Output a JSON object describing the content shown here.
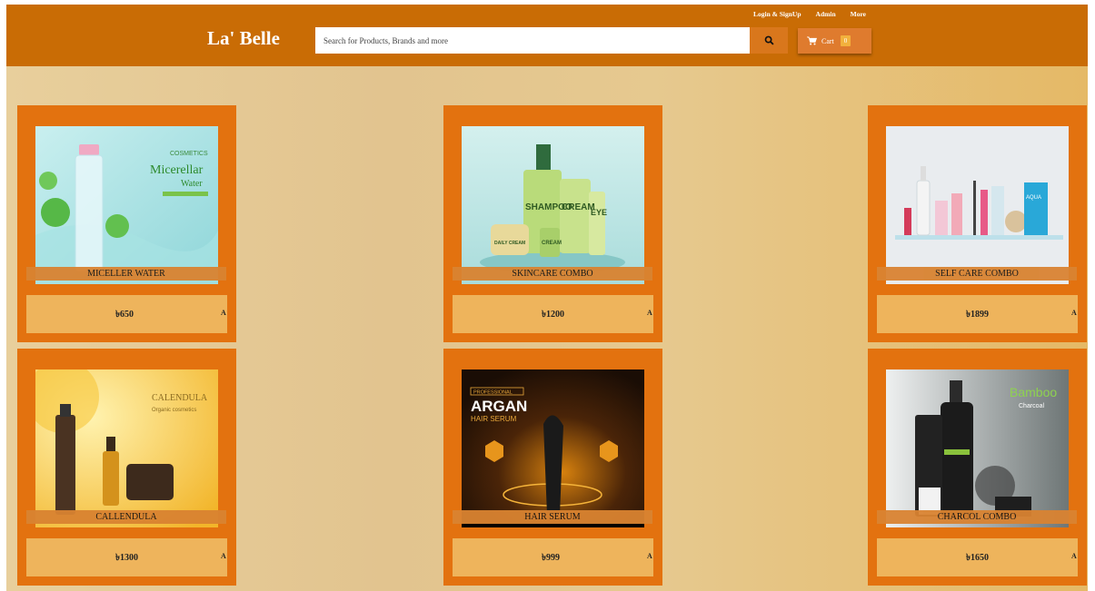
{
  "header": {
    "logo": "La' Belle",
    "links": [
      "Login & SignUp",
      "Admin",
      "More"
    ],
    "search_placeholder": "Search for Products, Brands and more",
    "cart_label": "Cart",
    "cart_count": "0"
  },
  "colors": {
    "header": "#c96c05",
    "card": "#e3720f",
    "price_box": "#eeb45c"
  },
  "products": [
    {
      "name": "MICELLER WATER",
      "price": "৳650",
      "add_label": "Add to Cart",
      "image_text": [
        "COSMETICS",
        "Micerellar",
        "Water"
      ]
    },
    {
      "name": "SKINCARE COMBO",
      "price": "৳1200",
      "add_label": "Add to Cart",
      "image_text": [
        "SHAMPOO",
        "CREAM",
        "EYE",
        "CREAM",
        "DAILY CREAM"
      ]
    },
    {
      "name": "SELF CARE COMBO",
      "price": "৳1899",
      "add_label": "Add to Cart",
      "image_text": [
        "AQUA"
      ]
    },
    {
      "name": "CALLENDULA",
      "price": "৳1300",
      "add_label": "Add to Cart",
      "image_text": [
        "CALENDULA",
        "Organic cosmetics"
      ]
    },
    {
      "name": "HAIR SERUM",
      "price": "৳999",
      "add_label": "Add to Cart",
      "image_text": [
        "PROFESSIONAL",
        "ARGAN",
        "HAIR SERUM"
      ]
    },
    {
      "name": "CHARCOL COMBO",
      "price": "৳1650",
      "add_label": "Add to Cart",
      "image_text": [
        "Bamboo",
        "Charcoal"
      ]
    }
  ]
}
